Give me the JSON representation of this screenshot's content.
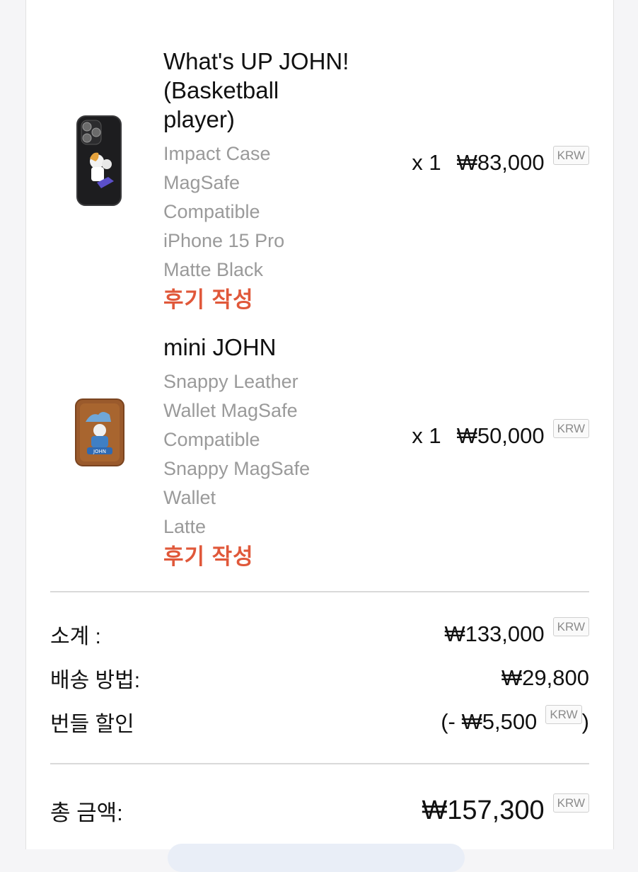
{
  "items": [
    {
      "title": "What's UP JOHN! (Basketball player)",
      "title_lines": [
        "What's UP JOHN!",
        "(Basketball",
        "player)"
      ],
      "options": [
        "Impact Case",
        "MagSafe",
        "Compatible",
        "iPhone 15 Pro",
        "Matte Black"
      ],
      "review_label": "후기 작성",
      "qty": "x 1",
      "price": "₩83,000",
      "currency": "KRW",
      "thumb_icon": "phone-case-image"
    },
    {
      "title": "mini JOHN",
      "title_lines": [
        "mini JOHN"
      ],
      "options": [
        "Snappy Leather",
        "Wallet MagSafe",
        "Compatible",
        "Snappy MagSafe",
        "Wallet",
        "Latte"
      ],
      "review_label": "후기 작성",
      "qty": "x 1",
      "price": "₩50,000",
      "currency": "KRW",
      "thumb_icon": "wallet-image"
    }
  ],
  "summary": {
    "subtotal_label": "소계 :",
    "subtotal_value": "₩133,000",
    "subtotal_currency": "KRW",
    "shipping_label": "배송 방법:",
    "shipping_value": "₩29,800",
    "discount_label": "번들 할인",
    "discount_prefix": "(- ₩5,500",
    "discount_currency": "KRW",
    "discount_suffix": ")"
  },
  "total": {
    "label": "총 금액:",
    "value": "₩157,300",
    "currency": "KRW"
  },
  "colors": {
    "review": "#e0583a",
    "option_text": "#9a9a9a",
    "divider": "#d9d9d9",
    "case_black": "#1d1d1f",
    "wallet_brown": "#9a5a2c"
  }
}
